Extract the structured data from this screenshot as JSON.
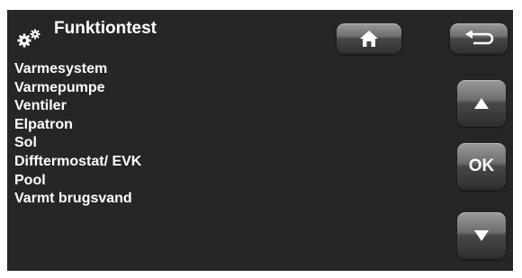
{
  "header": {
    "title": "Funktiontest",
    "icon": "gears-icon"
  },
  "menu": {
    "items": [
      {
        "label": "Varmesystem"
      },
      {
        "label": "Varmepumpe"
      },
      {
        "label": "Ventiler"
      },
      {
        "label": "Elpatron"
      },
      {
        "label": "Sol"
      },
      {
        "label": "Difftermostat/ EVK"
      },
      {
        "label": "Pool"
      },
      {
        "label": "Varmt brugsvand"
      }
    ]
  },
  "buttons": {
    "home_icon": "home-icon",
    "back_icon": "back-arrow-icon",
    "up_icon": "arrow-up-icon",
    "ok_label": "OK",
    "down_icon": "arrow-down-icon"
  },
  "colors": {
    "background": "#262626",
    "text": "#ffffff",
    "button_top": "#9a9a9a",
    "button_bottom": "#2e2e2e"
  }
}
